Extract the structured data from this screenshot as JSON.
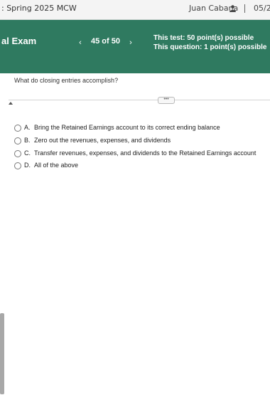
{
  "header": {
    "course_title": ": Spring 2025 MCW",
    "user_name": "Juan Cabana",
    "date": "05/2"
  },
  "exam": {
    "title": "al Exam",
    "prev_label": "‹",
    "next_label": "›",
    "counter": "45 of 50",
    "test_points": "This test: 50 point(s) possible",
    "question_points": "This question: 1 point(s) possible"
  },
  "question": {
    "text": "What do closing entries accomplish?",
    "more_label": "•••",
    "options": [
      {
        "letter": "A.",
        "text": "Bring the Retained Earnings account to its correct ending balance"
      },
      {
        "letter": "B.",
        "text": "Zero out the revenues, expenses, and dividends"
      },
      {
        "letter": "C.",
        "text": "Transfer revenues, expenses, and dividends to the Retained Earnings account"
      },
      {
        "letter": "D.",
        "text": "All of the above"
      }
    ]
  },
  "colors": {
    "header_green": "#2f7a60",
    "topbar_bg": "#f4f4f4"
  },
  "icons": {
    "user": "user-icon",
    "collapse": "caret-up-icon",
    "more": "ellipsis-icon"
  }
}
